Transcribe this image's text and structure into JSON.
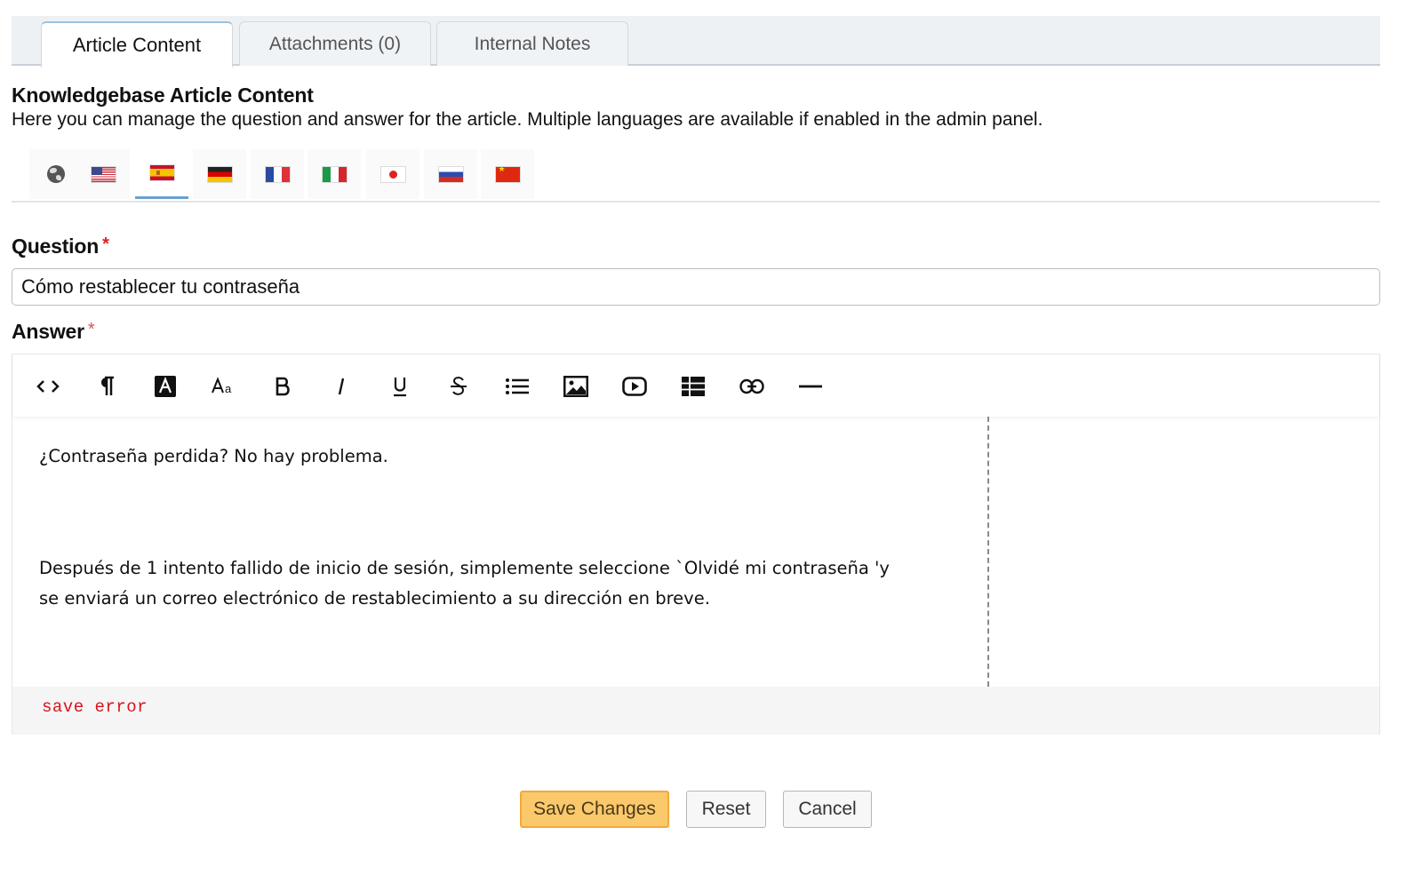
{
  "tabs": [
    {
      "label": "Article Content",
      "active": true
    },
    {
      "label": "Attachments (0)",
      "active": false
    },
    {
      "label": "Internal Notes",
      "active": false
    }
  ],
  "section": {
    "title": "Knowledgebase Article Content",
    "description": "Here you can manage the question and answer for the article. Multiple languages are available if enabled in the admin panel."
  },
  "languages": [
    {
      "code": "global",
      "icon": "globe-icon"
    },
    {
      "code": "en",
      "icon": "flag-us-icon"
    },
    {
      "code": "es",
      "icon": "flag-es-icon",
      "active": true
    },
    {
      "code": "de",
      "icon": "flag-de-icon"
    },
    {
      "code": "fr",
      "icon": "flag-fr-icon"
    },
    {
      "code": "it",
      "icon": "flag-it-icon"
    },
    {
      "code": "ja",
      "icon": "flag-jp-icon"
    },
    {
      "code": "ru",
      "icon": "flag-ru-icon"
    },
    {
      "code": "zh",
      "icon": "flag-cn-icon"
    }
  ],
  "form": {
    "question_label": "Question",
    "question_value": "Cómo restablecer tu contraseña",
    "answer_label": "Answer",
    "required_mark": "*"
  },
  "editor": {
    "toolbar": [
      "code-view-icon",
      "paragraph-icon",
      "font-color-icon",
      "font-size-icon",
      "bold-icon",
      "italic-icon",
      "underline-icon",
      "strikethrough-icon",
      "list-icon",
      "image-icon",
      "video-icon",
      "table-icon",
      "link-icon",
      "horizontal-rule-icon"
    ],
    "paragraph1": "¿Contraseña perdida? No hay problema.",
    "paragraph2_line1": "Después de 1 intento fallido de inicio de sesión, simplemente seleccione `Olvidé mi contraseña 'y",
    "paragraph2_line2": "se enviará un correo electrónico de restablecimiento a su dirección en breve.",
    "status": "save error"
  },
  "buttons": {
    "save": "Save Changes",
    "reset": "Reset",
    "cancel": "Cancel"
  },
  "colors": {
    "accent": "#fbc96b",
    "error": "#d8131b",
    "required": "#d22222",
    "active_tab_border": "#6a9fd0"
  }
}
